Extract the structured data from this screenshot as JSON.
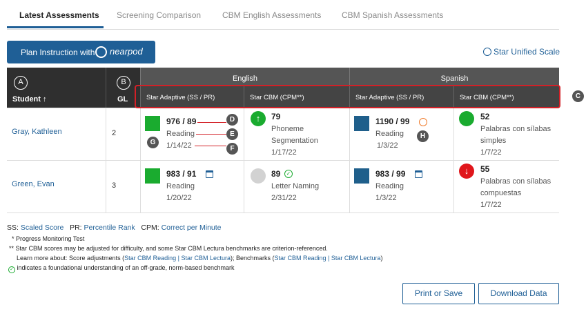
{
  "tabs": [
    "Latest Assessments",
    "Screening Comparison",
    "CBM English Assessments",
    "CBM Spanish Assessments"
  ],
  "plan_button": {
    "label": "Plan Instruction with",
    "brand": "nearpod"
  },
  "scale_link": "Star Unified Scale",
  "header": {
    "student": "Student",
    "gl": "GL",
    "english": "English",
    "spanish": "Spanish",
    "sub": [
      "Star Adaptive (SS / PR)",
      "Star CBM (CPM**)",
      "Star Adaptive (SS / PR)",
      "Star CBM (CPM**)"
    ],
    "callout_a": "A",
    "callout_b": "B",
    "callout_c": "C"
  },
  "rows": [
    {
      "name": "Gray, Kathleen",
      "gl": "2",
      "eng_adaptive": {
        "score": "976 / 89",
        "subject": "Reading",
        "date": "1/14/22"
      },
      "eng_cbm": {
        "score": "79",
        "subject_line1": "Phoneme",
        "subject_line2": "Segmentation",
        "date": "1/17/22",
        "arrow": "↑"
      },
      "spa_adaptive": {
        "score": "1190 / 99",
        "subject": "Reading",
        "date": "1/3/22"
      },
      "spa_cbm": {
        "score": "52",
        "subject_line1": "Palabras con sílabas",
        "subject_line2": "simples",
        "date": "1/7/22"
      }
    },
    {
      "name": "Green, Evan",
      "gl": "3",
      "eng_adaptive": {
        "score": "983 / 91",
        "subject": "Reading",
        "date": "1/20/22"
      },
      "eng_cbm": {
        "score": "89",
        "subject_line1": "Letter Naming",
        "date": "2/31/22"
      },
      "spa_adaptive": {
        "score": "983 / 99",
        "subject": "Reading",
        "date": "1/3/22"
      },
      "spa_cbm": {
        "score": "55",
        "subject_line1": "Palabras con sílabas",
        "subject_line2": "compuestas",
        "date": "1/7/22",
        "arrow": "↓"
      }
    }
  ],
  "callouts": {
    "d": "D",
    "e": "E",
    "f": "F",
    "g": "G",
    "h": "H"
  },
  "legend": {
    "ss_prefix": "SS:",
    "ss": "Scaled Score",
    "pr_prefix": "PR:",
    "pr": "Percentile Rank",
    "cpm_prefix": "CPM:",
    "cpm": "Correct per Minute"
  },
  "notes": {
    "pmt": "* Progress Monitoring Test",
    "cbm_note": "** Star CBM scores may be adjusted for difficulty, and some Star CBM Lectura benchmarks are criterion-referenced.",
    "learn_prefix": "Learn more about: Score adjustments (",
    "link1": "Star CBM Reading",
    "sep": " | ",
    "link2": "Star CBM Lectura",
    "mid": "); Benchmarks (",
    "link3": "Star CBM Reading",
    "link4": "Star CBM Lectura",
    "close": ")",
    "check_note": "indicates a foundational understanding of an off-grade, norm-based benchmark"
  },
  "buttons": {
    "print": "Print or Save",
    "download": "Download Data"
  }
}
